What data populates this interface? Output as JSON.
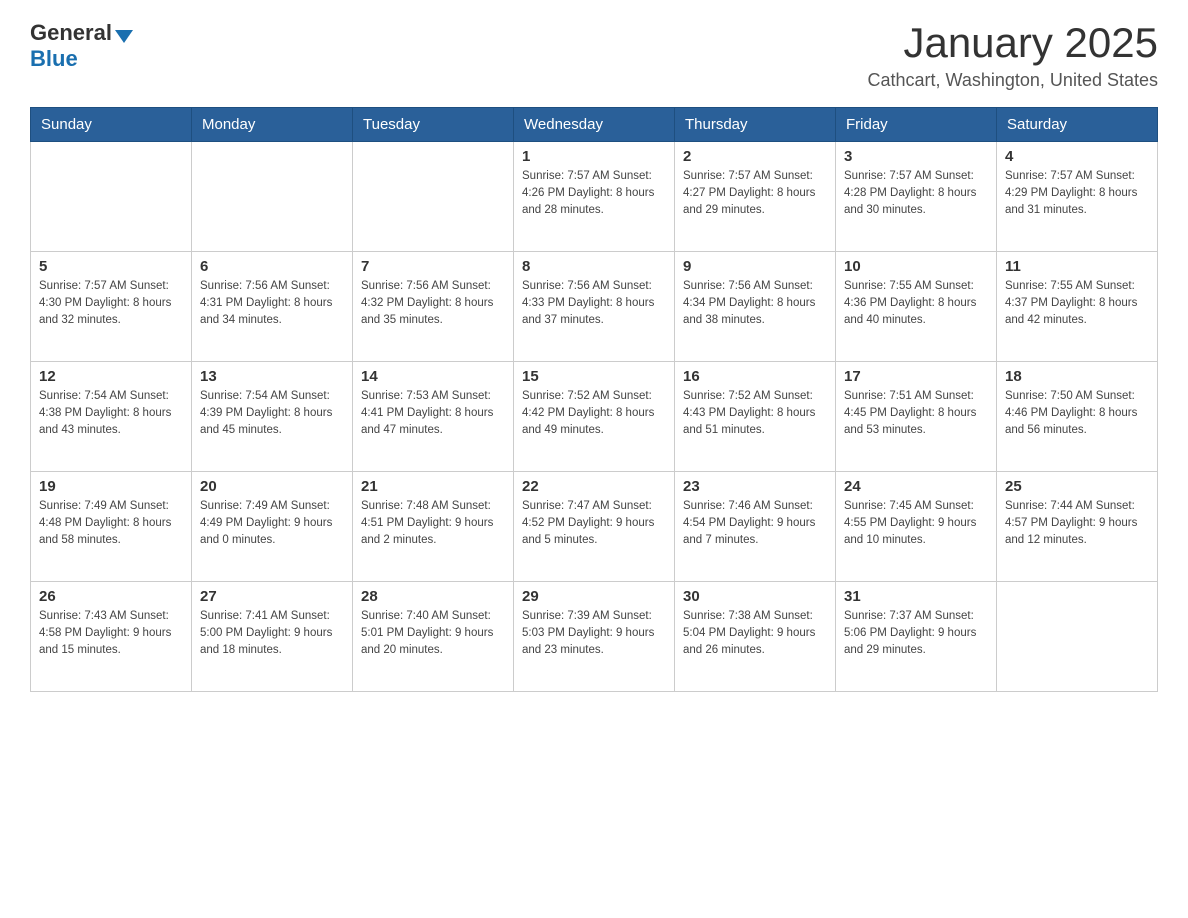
{
  "header": {
    "logo_general": "General",
    "logo_blue": "Blue",
    "title": "January 2025",
    "subtitle": "Cathcart, Washington, United States"
  },
  "calendar": {
    "days_of_week": [
      "Sunday",
      "Monday",
      "Tuesday",
      "Wednesday",
      "Thursday",
      "Friday",
      "Saturday"
    ],
    "weeks": [
      [
        {
          "day": "",
          "info": ""
        },
        {
          "day": "",
          "info": ""
        },
        {
          "day": "",
          "info": ""
        },
        {
          "day": "1",
          "info": "Sunrise: 7:57 AM\nSunset: 4:26 PM\nDaylight: 8 hours\nand 28 minutes."
        },
        {
          "day": "2",
          "info": "Sunrise: 7:57 AM\nSunset: 4:27 PM\nDaylight: 8 hours\nand 29 minutes."
        },
        {
          "day": "3",
          "info": "Sunrise: 7:57 AM\nSunset: 4:28 PM\nDaylight: 8 hours\nand 30 minutes."
        },
        {
          "day": "4",
          "info": "Sunrise: 7:57 AM\nSunset: 4:29 PM\nDaylight: 8 hours\nand 31 minutes."
        }
      ],
      [
        {
          "day": "5",
          "info": "Sunrise: 7:57 AM\nSunset: 4:30 PM\nDaylight: 8 hours\nand 32 minutes."
        },
        {
          "day": "6",
          "info": "Sunrise: 7:56 AM\nSunset: 4:31 PM\nDaylight: 8 hours\nand 34 minutes."
        },
        {
          "day": "7",
          "info": "Sunrise: 7:56 AM\nSunset: 4:32 PM\nDaylight: 8 hours\nand 35 minutes."
        },
        {
          "day": "8",
          "info": "Sunrise: 7:56 AM\nSunset: 4:33 PM\nDaylight: 8 hours\nand 37 minutes."
        },
        {
          "day": "9",
          "info": "Sunrise: 7:56 AM\nSunset: 4:34 PM\nDaylight: 8 hours\nand 38 minutes."
        },
        {
          "day": "10",
          "info": "Sunrise: 7:55 AM\nSunset: 4:36 PM\nDaylight: 8 hours\nand 40 minutes."
        },
        {
          "day": "11",
          "info": "Sunrise: 7:55 AM\nSunset: 4:37 PM\nDaylight: 8 hours\nand 42 minutes."
        }
      ],
      [
        {
          "day": "12",
          "info": "Sunrise: 7:54 AM\nSunset: 4:38 PM\nDaylight: 8 hours\nand 43 minutes."
        },
        {
          "day": "13",
          "info": "Sunrise: 7:54 AM\nSunset: 4:39 PM\nDaylight: 8 hours\nand 45 minutes."
        },
        {
          "day": "14",
          "info": "Sunrise: 7:53 AM\nSunset: 4:41 PM\nDaylight: 8 hours\nand 47 minutes."
        },
        {
          "day": "15",
          "info": "Sunrise: 7:52 AM\nSunset: 4:42 PM\nDaylight: 8 hours\nand 49 minutes."
        },
        {
          "day": "16",
          "info": "Sunrise: 7:52 AM\nSunset: 4:43 PM\nDaylight: 8 hours\nand 51 minutes."
        },
        {
          "day": "17",
          "info": "Sunrise: 7:51 AM\nSunset: 4:45 PM\nDaylight: 8 hours\nand 53 minutes."
        },
        {
          "day": "18",
          "info": "Sunrise: 7:50 AM\nSunset: 4:46 PM\nDaylight: 8 hours\nand 56 minutes."
        }
      ],
      [
        {
          "day": "19",
          "info": "Sunrise: 7:49 AM\nSunset: 4:48 PM\nDaylight: 8 hours\nand 58 minutes."
        },
        {
          "day": "20",
          "info": "Sunrise: 7:49 AM\nSunset: 4:49 PM\nDaylight: 9 hours\nand 0 minutes."
        },
        {
          "day": "21",
          "info": "Sunrise: 7:48 AM\nSunset: 4:51 PM\nDaylight: 9 hours\nand 2 minutes."
        },
        {
          "day": "22",
          "info": "Sunrise: 7:47 AM\nSunset: 4:52 PM\nDaylight: 9 hours\nand 5 minutes."
        },
        {
          "day": "23",
          "info": "Sunrise: 7:46 AM\nSunset: 4:54 PM\nDaylight: 9 hours\nand 7 minutes."
        },
        {
          "day": "24",
          "info": "Sunrise: 7:45 AM\nSunset: 4:55 PM\nDaylight: 9 hours\nand 10 minutes."
        },
        {
          "day": "25",
          "info": "Sunrise: 7:44 AM\nSunset: 4:57 PM\nDaylight: 9 hours\nand 12 minutes."
        }
      ],
      [
        {
          "day": "26",
          "info": "Sunrise: 7:43 AM\nSunset: 4:58 PM\nDaylight: 9 hours\nand 15 minutes."
        },
        {
          "day": "27",
          "info": "Sunrise: 7:41 AM\nSunset: 5:00 PM\nDaylight: 9 hours\nand 18 minutes."
        },
        {
          "day": "28",
          "info": "Sunrise: 7:40 AM\nSunset: 5:01 PM\nDaylight: 9 hours\nand 20 minutes."
        },
        {
          "day": "29",
          "info": "Sunrise: 7:39 AM\nSunset: 5:03 PM\nDaylight: 9 hours\nand 23 minutes."
        },
        {
          "day": "30",
          "info": "Sunrise: 7:38 AM\nSunset: 5:04 PM\nDaylight: 9 hours\nand 26 minutes."
        },
        {
          "day": "31",
          "info": "Sunrise: 7:37 AM\nSunset: 5:06 PM\nDaylight: 9 hours\nand 29 minutes."
        },
        {
          "day": "",
          "info": ""
        }
      ]
    ]
  }
}
